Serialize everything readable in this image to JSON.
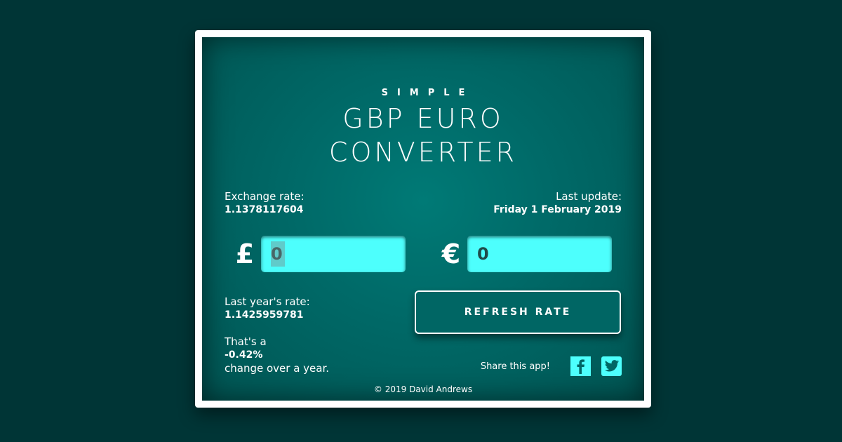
{
  "header": {
    "kicker": "SIMPLE",
    "title_line1": "GBP EURO",
    "title_line2": "CONVERTER"
  },
  "exchange_rate": {
    "label": "Exchange rate:",
    "value": "1.1378117604"
  },
  "last_update": {
    "label": "Last update:",
    "value": "Friday 1 February 2019"
  },
  "converter": {
    "gbp_symbol": "£",
    "gbp_value": "0",
    "eur_symbol": "€",
    "eur_value": "0"
  },
  "last_year": {
    "label": "Last year's rate:",
    "value": "1.1425959781"
  },
  "change": {
    "prefix": "That's a",
    "value": "-0.42%",
    "suffix": "change over a year."
  },
  "refresh_button": {
    "label": "REFRESH RATE"
  },
  "share": {
    "label": "Share this app!",
    "icons": [
      "facebook-icon",
      "twitter-icon"
    ]
  },
  "footer": {
    "copyright": "© 2019 David Andrews"
  },
  "colors": {
    "background": "#003536",
    "panel": "#006a68",
    "accent": "#4dfffd",
    "text": "#ffffff"
  }
}
